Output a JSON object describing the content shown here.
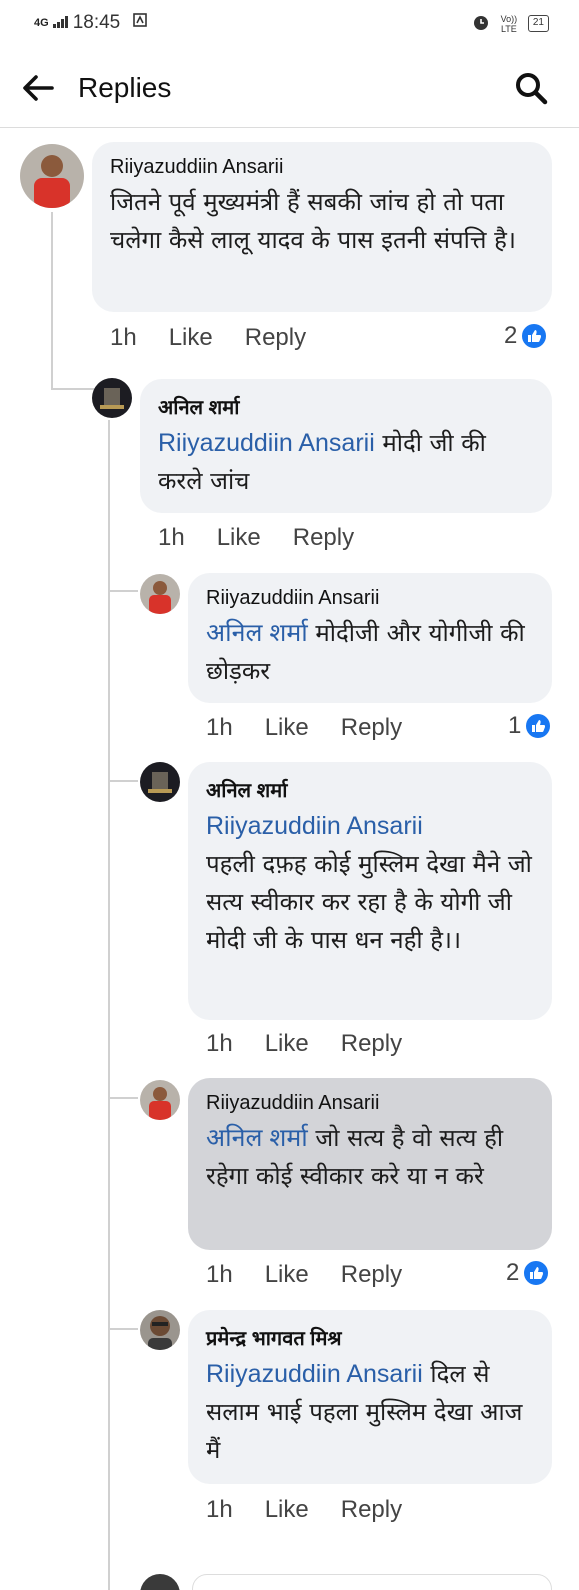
{
  "status_bar": {
    "network": "4G",
    "time": "18:45",
    "volte": "Vo)) LTE",
    "battery": "21"
  },
  "header": {
    "title": "Replies"
  },
  "comments": [
    {
      "author": "Riiyazuddiin Ansarii",
      "mention": "",
      "text": "जितने पूर्व मुख्यमंत्री हैं सबकी जांच हो तो पता चलेगा कैसे लालू यादव के पास इतनी संपत्ति है।",
      "time": "1h",
      "like": "Like",
      "reply": "Reply",
      "reaction_count": "2"
    },
    {
      "author": "अनिल शर्मा",
      "mention": "Riiyazuddiin Ansarii",
      "text": " मोदी जी की करले जांच",
      "time": "1h",
      "like": "Like",
      "reply": "Reply",
      "reaction_count": ""
    },
    {
      "author": "Riiyazuddiin Ansarii",
      "mention": "अनिल शर्मा",
      "text": " मोदीजी और योगीजी की छोड़कर",
      "time": "1h",
      "like": "Like",
      "reply": "Reply",
      "reaction_count": "1"
    },
    {
      "author": "अनिल शर्मा",
      "mention": "Riiyazuddiin Ansarii",
      "text": "पहली दफ़ह कोई मुस्लिम देखा मैने जो सत्य स्वीकार कर रहा है के योगी जी मोदी जी के पास धन नही है।।",
      "time": "1h",
      "like": "Like",
      "reply": "Reply",
      "reaction_count": ""
    },
    {
      "author": "Riiyazuddiin Ansarii",
      "mention": "अनिल शर्मा",
      "text": " जो सत्य है वो सत्य ही रहेगा कोई स्वीकार करे या न करे",
      "time": "1h",
      "like": "Like",
      "reply": "Reply",
      "reaction_count": "2"
    },
    {
      "author": "प्रमेन्द्र भागवत मिश्र",
      "mention": "Riiyazuddiin Ansarii",
      "text": " दिल से सलाम भाई पहला मुस्लिम देखा आज मैं",
      "time": "1h",
      "like": "Like",
      "reply": "Reply",
      "reaction_count": ""
    }
  ],
  "colors": {
    "mention": "#2a5fa8",
    "bubble": "#f0f2f5",
    "bubble_pressed": "#d3d4d8",
    "like_badge": "#1877f2"
  }
}
